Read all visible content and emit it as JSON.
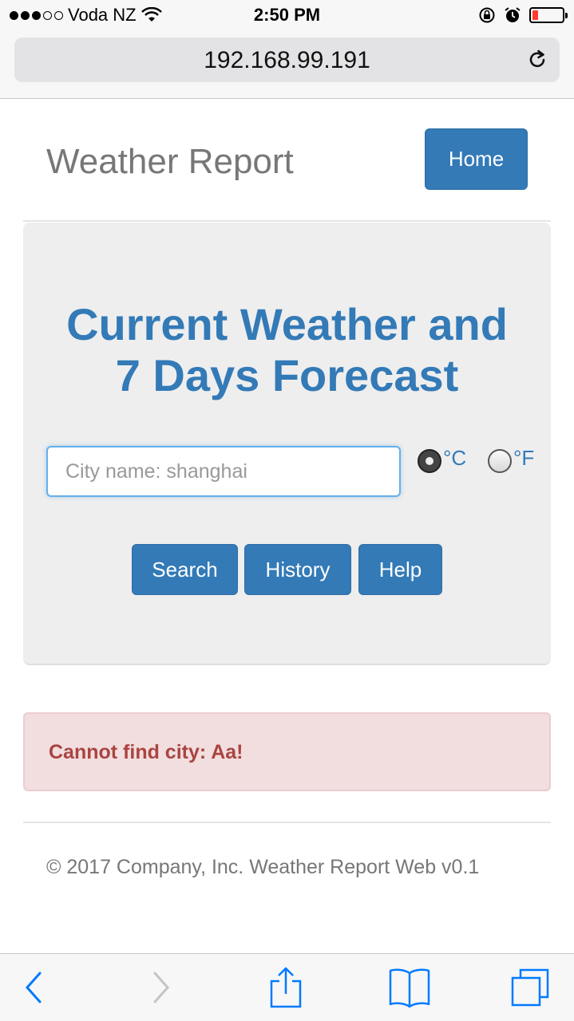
{
  "status_bar": {
    "carrier": "Voda NZ",
    "time": "2:50 PM",
    "signal_bars_filled": 3,
    "signal_bars_total": 5,
    "battery_level": 0.15
  },
  "browser": {
    "url": "192.168.99.191"
  },
  "navbar": {
    "brand": "Weather Report",
    "home_label": "Home"
  },
  "hero": {
    "title_line1": "Current Weather and",
    "title_line2": "7 Days Forecast",
    "city_placeholder": "City name: shanghai",
    "unit_celsius": "°C",
    "unit_fahrenheit": "°F",
    "selected_unit": "°C",
    "search_label": "Search",
    "history_label": "History",
    "help_label": "Help"
  },
  "alert": {
    "message": "Cannot find city: Aa!"
  },
  "footer": {
    "text": "© 2017 Company, Inc. Weather Report Web v0.1"
  },
  "colors": {
    "primary": "#337ab7",
    "alert_bg": "#f2dede",
    "alert_text": "#a94442",
    "ios_blue": "#007aff"
  }
}
